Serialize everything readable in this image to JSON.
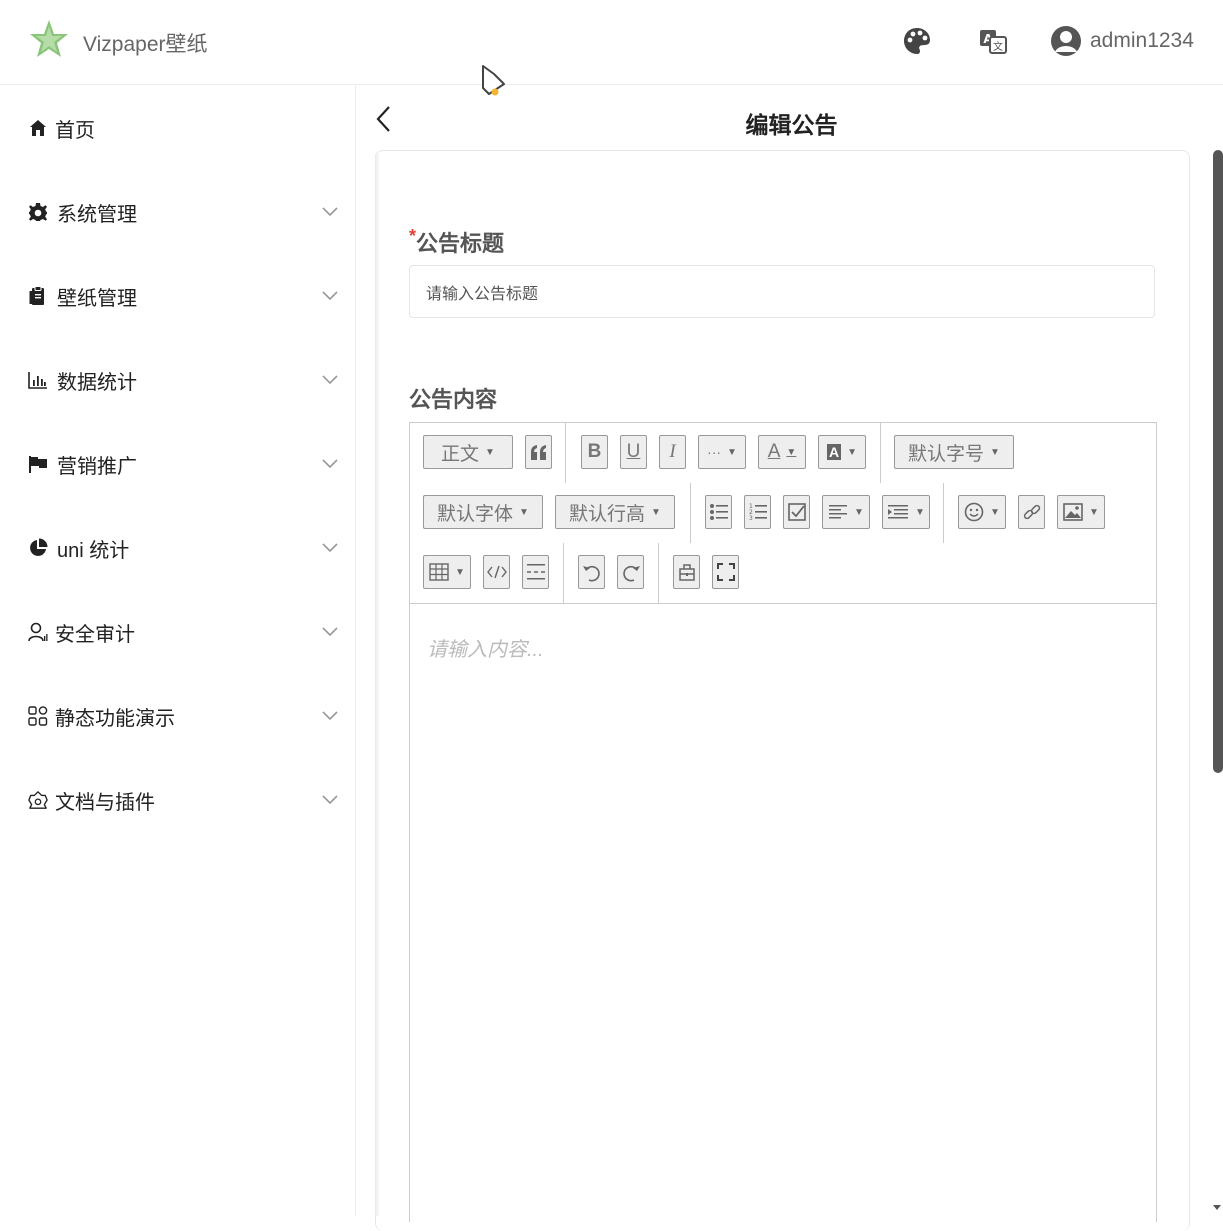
{
  "header": {
    "app_title": "Vizpaper壁纸",
    "username": "admin1234",
    "icons": [
      "star-logo-icon",
      "palette-icon",
      "translate-icon",
      "user-avatar-icon"
    ]
  },
  "sidebar": {
    "items": [
      {
        "label": "首页",
        "icon": "home-icon"
      },
      {
        "label": "系统管理",
        "icon": "gear-icon"
      },
      {
        "label": "壁纸管理",
        "icon": "clipboard-icon"
      },
      {
        "label": "数据统计",
        "icon": "bar-chart-icon"
      },
      {
        "label": "营销推广",
        "icon": "flag-icon"
      },
      {
        "label": "uni 统计",
        "icon": "pie-chart-icon"
      },
      {
        "label": "安全审计",
        "icon": "person-icon"
      },
      {
        "label": "静态功能演示",
        "icon": "grid-icon"
      },
      {
        "label": "文档与插件",
        "icon": "plugin-icon"
      }
    ]
  },
  "page": {
    "title": "编辑公告",
    "title_field": {
      "required_mark": "*",
      "label": "公告标题",
      "placeholder": "请输入公告标题"
    },
    "content_field": {
      "label": "公告内容",
      "placeholder": "请输入内容..."
    }
  },
  "toolbar": {
    "paragraph": "正文",
    "font_size": "默认字号",
    "font_family": "默认字体",
    "line_height": "默认行高",
    "bold": "B",
    "underline": "U",
    "italic": "I",
    "more": "···",
    "font_color": "A",
    "bg_color": "A"
  },
  "colors": {
    "accent_green": "#7cc26a",
    "required_red": "#e43d33",
    "scrollbar": "#555555"
  }
}
